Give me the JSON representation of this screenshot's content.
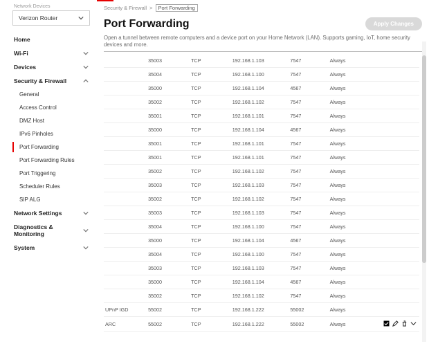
{
  "sidebar": {
    "devices_label": "Network Devices",
    "router": "Verizon Router",
    "items": [
      {
        "label": "Home",
        "type": "top",
        "expand": ""
      },
      {
        "label": "Wi-Fi",
        "type": "top",
        "expand": "down"
      },
      {
        "label": "Devices",
        "type": "top",
        "expand": "down"
      },
      {
        "label": "Security & Firewall",
        "type": "top",
        "expand": "up"
      },
      {
        "label": "General",
        "type": "sub"
      },
      {
        "label": "Access Control",
        "type": "sub"
      },
      {
        "label": "DMZ Host",
        "type": "sub"
      },
      {
        "label": "IPv6 Pinholes",
        "type": "sub"
      },
      {
        "label": "Port Forwarding",
        "type": "sub",
        "active": true
      },
      {
        "label": "Port Forwarding Rules",
        "type": "sub"
      },
      {
        "label": "Port Triggering",
        "type": "sub"
      },
      {
        "label": "Scheduler Rules",
        "type": "sub"
      },
      {
        "label": "SIP ALG",
        "type": "sub"
      },
      {
        "label": "Network Settings",
        "type": "top",
        "expand": "down"
      },
      {
        "label": "Diagnostics & Monitoring",
        "type": "top",
        "expand": "down"
      },
      {
        "label": "System",
        "type": "top",
        "expand": "down"
      }
    ]
  },
  "breadcrumb": {
    "a": "Security & Firewall",
    "b": "Port Forwarding"
  },
  "page": {
    "title": "Port Forwarding",
    "apply": "Apply Changes",
    "desc": "Open a tunnel between remote computers and a device port on your Home Network (LAN). Supports gaming, IoT, home security devices and more."
  },
  "rows": [
    {
      "app": "",
      "port": "35003",
      "proto": "TCP",
      "ip": "192.168.1.103",
      "fwd": "7547",
      "sched": "Always"
    },
    {
      "app": "",
      "port": "35004",
      "proto": "TCP",
      "ip": "192.168.1.100",
      "fwd": "7547",
      "sched": "Always"
    },
    {
      "app": "",
      "port": "35000",
      "proto": "TCP",
      "ip": "192.168.1.104",
      "fwd": "4567",
      "sched": "Always"
    },
    {
      "app": "",
      "port": "35002",
      "proto": "TCP",
      "ip": "192.168.1.102",
      "fwd": "7547",
      "sched": "Always"
    },
    {
      "app": "",
      "port": "35001",
      "proto": "TCP",
      "ip": "192.168.1.101",
      "fwd": "7547",
      "sched": "Always"
    },
    {
      "app": "",
      "port": "35000",
      "proto": "TCP",
      "ip": "192.168.1.104",
      "fwd": "4567",
      "sched": "Always"
    },
    {
      "app": "",
      "port": "35001",
      "proto": "TCP",
      "ip": "192.168.1.101",
      "fwd": "7547",
      "sched": "Always"
    },
    {
      "app": "",
      "port": "35001",
      "proto": "TCP",
      "ip": "192.168.1.101",
      "fwd": "7547",
      "sched": "Always"
    },
    {
      "app": "",
      "port": "35002",
      "proto": "TCP",
      "ip": "192.168.1.102",
      "fwd": "7547",
      "sched": "Always"
    },
    {
      "app": "",
      "port": "35003",
      "proto": "TCP",
      "ip": "192.168.1.103",
      "fwd": "7547",
      "sched": "Always"
    },
    {
      "app": "",
      "port": "35002",
      "proto": "TCP",
      "ip": "192.168.1.102",
      "fwd": "7547",
      "sched": "Always"
    },
    {
      "app": "",
      "port": "35003",
      "proto": "TCP",
      "ip": "192.168.1.103",
      "fwd": "7547",
      "sched": "Always"
    },
    {
      "app": "",
      "port": "35004",
      "proto": "TCP",
      "ip": "192.168.1.100",
      "fwd": "7547",
      "sched": "Always"
    },
    {
      "app": "",
      "port": "35000",
      "proto": "TCP",
      "ip": "192.168.1.104",
      "fwd": "4567",
      "sched": "Always"
    },
    {
      "app": "",
      "port": "35004",
      "proto": "TCP",
      "ip": "192.168.1.100",
      "fwd": "7547",
      "sched": "Always"
    },
    {
      "app": "",
      "port": "35003",
      "proto": "TCP",
      "ip": "192.168.1.103",
      "fwd": "7547",
      "sched": "Always"
    },
    {
      "app": "",
      "port": "35000",
      "proto": "TCP",
      "ip": "192.168.1.104",
      "fwd": "4567",
      "sched": "Always"
    },
    {
      "app": "",
      "port": "35002",
      "proto": "TCP",
      "ip": "192.168.1.102",
      "fwd": "7547",
      "sched": "Always"
    },
    {
      "app": "UPnP IGD",
      "port": "55002",
      "proto": "TCP",
      "ip": "192.168.1.222",
      "fwd": "55002",
      "sched": "Always"
    },
    {
      "app": "ARC",
      "port": "55002",
      "proto": "TCP",
      "ip": "192.168.1.222",
      "fwd": "55002",
      "sched": "Always",
      "actions": true
    }
  ]
}
